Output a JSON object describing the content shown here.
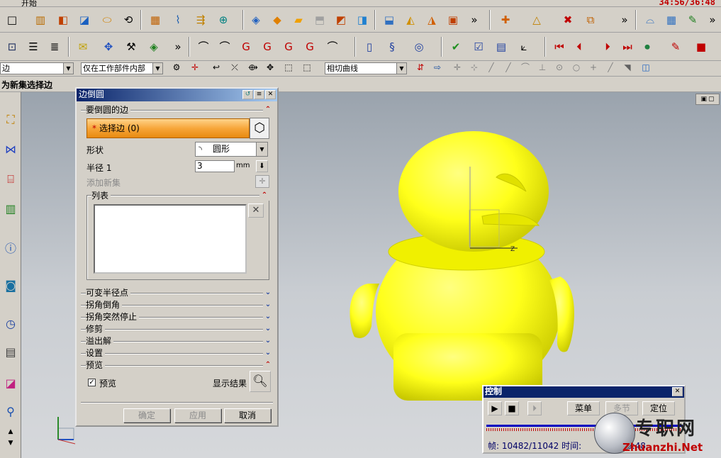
{
  "app": {
    "timer": "34:56/36:48",
    "top_strip_label": "开始"
  },
  "toolbar3": {
    "filter_combo": "边",
    "scope_combo": "仅在工作部件内部",
    "curve_rule_combo": "相切曲线"
  },
  "status": {
    "prompt": "为新集选择边"
  },
  "dialog": {
    "title": "边倒圆",
    "sections": {
      "edges": "要倒圆的边",
      "variable_radius": "可变半径点",
      "corner_setback": "拐角倒角",
      "stop_short": "拐角突然停止",
      "trim": "修剪",
      "overflow": "溢出解",
      "settings": "设置",
      "preview": "预览"
    },
    "select_edge_label": "选择边 (0)",
    "shape_label": "形状",
    "shape_value": "圆形",
    "radius_label": "半径 1",
    "radius_value": "3",
    "radius_unit": "mm",
    "add_set_label": "添加新集",
    "list_label": "列表",
    "preview_label": "预览",
    "preview_checked": true,
    "show_result_label": "显示结果",
    "ok_label": "确定",
    "apply_label": "应用",
    "cancel_label": "取消"
  },
  "control": {
    "title": "控制",
    "menu_label": "菜单",
    "section_label": "多节",
    "locate_label": "定位",
    "frame_text": "帧: 10482/11042 时间:",
    "time_text": "6:48"
  },
  "watermark": {
    "cn": "专职网",
    "url": "Zhuanzhi.Net"
  },
  "colors": {
    "model": "#ffff1a",
    "accent": "#f7a63a",
    "title_bar": "#0a246a"
  }
}
